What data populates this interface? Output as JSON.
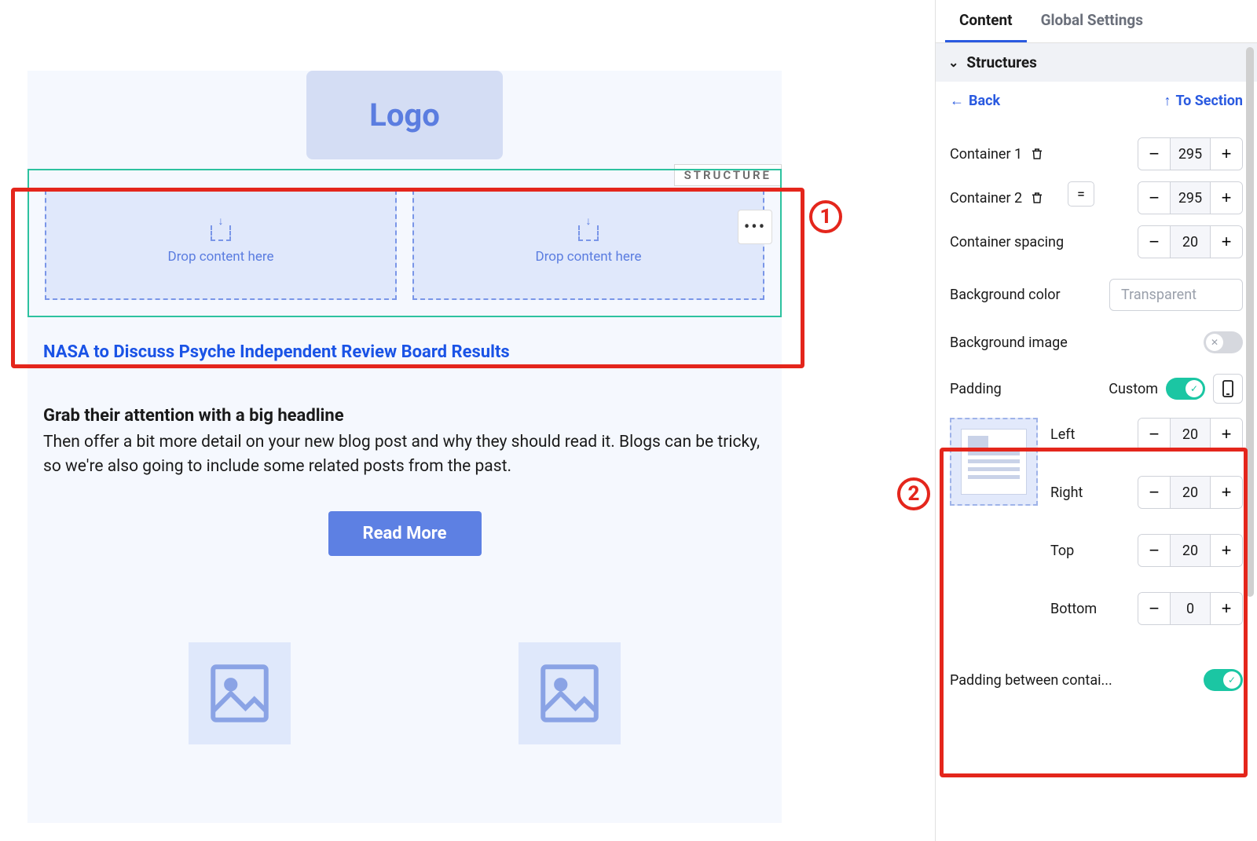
{
  "canvas": {
    "logo_text": "Logo",
    "structure_label": "STRUCTURE",
    "dropzone_text": "Drop content here",
    "more_symbol": "•••",
    "article_link": "NASA to Discuss Psyche Independent Review Board Results",
    "headline": "Grab their attention with a big headline",
    "body": "Then offer a bit more detail on your new blog post and why they should read it. Blogs can be tricky, so we're also going to include some related posts from the past.",
    "read_more": "Read More",
    "callout1_num": "1"
  },
  "sidebar": {
    "tabs": {
      "content": "Content",
      "global": "Global Settings"
    },
    "section_title": "Structures",
    "back": "Back",
    "to_section": "To Section",
    "containers": [
      {
        "label": "Container 1",
        "value": "295"
      },
      {
        "label": "Container 2",
        "value": "295"
      }
    ],
    "equalize": "=",
    "container_spacing_label": "Container spacing",
    "container_spacing_value": "20",
    "bg_color_label": "Background color",
    "bg_color_placeholder": "Transparent",
    "bg_image_label": "Background image",
    "padding": {
      "label": "Padding",
      "custom_label": "Custom",
      "sides": [
        {
          "name": "Left",
          "value": "20"
        },
        {
          "name": "Right",
          "value": "20"
        },
        {
          "name": "Top",
          "value": "20"
        },
        {
          "name": "Bottom",
          "value": "0"
        }
      ]
    },
    "padding_between_label": "Padding between contai...",
    "callout2_num": "2"
  }
}
